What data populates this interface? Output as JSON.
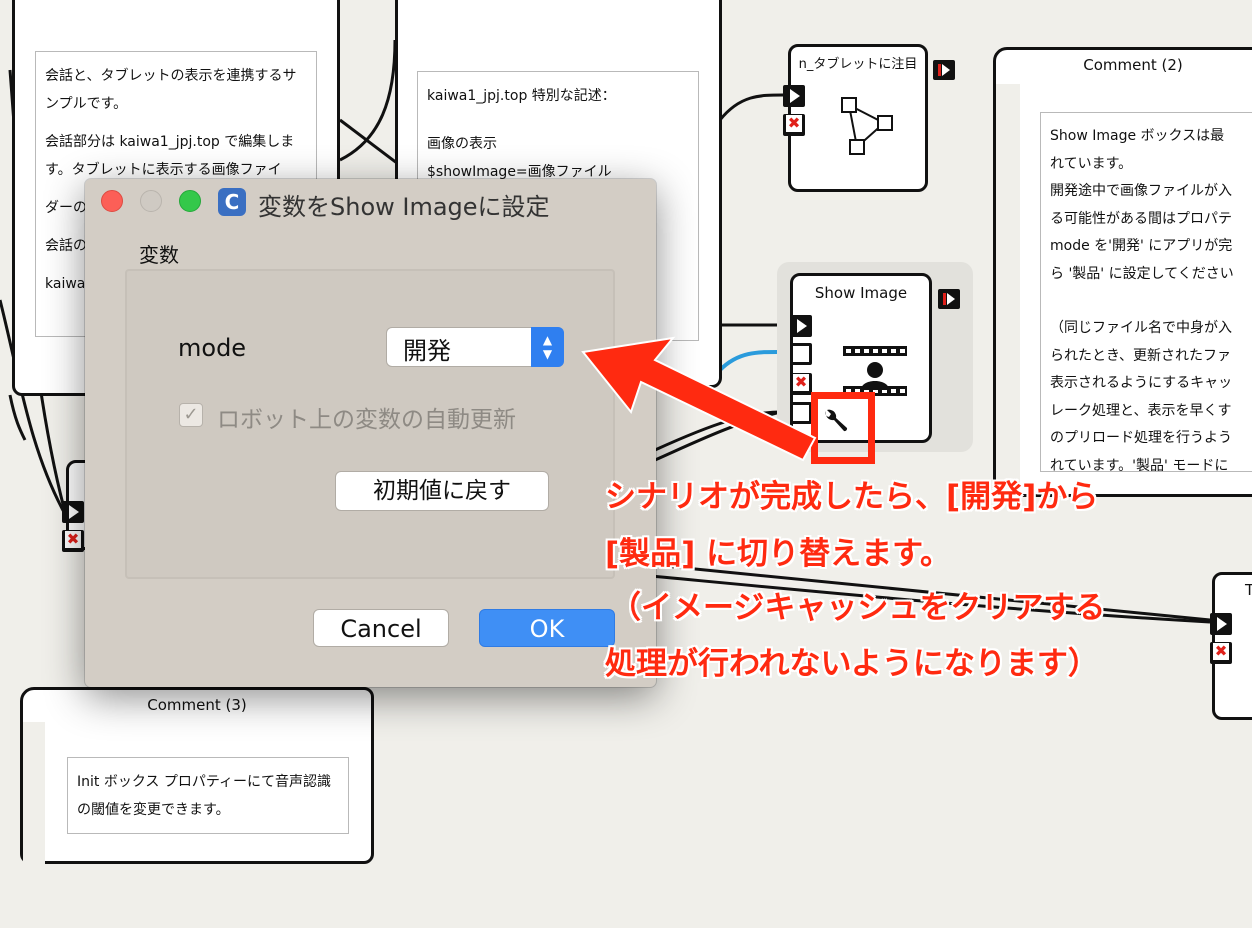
{
  "background_boxes": {
    "top_left_note": {
      "p1": "会話と、タブレットの表示を連携するサンプルです。",
      "p2": "会話部分は kaiwa1_jpj.top で編集します。タブレットに表示する画像ファイ",
      "p2_tail": "ダーの",
      "p3": "会話の",
      "p3_tail": "kaiwa"
    },
    "middle_note": {
      "line1": "kaiwa1_jpj.top 特別な記述：",
      "line2": "画像の表示",
      "line3": "$showImage=画像ファイル"
    },
    "tablet_box_title": "n_タブレットに注目",
    "show_image_box_title": "Show Image",
    "comment2": {
      "title": "Comment (2)",
      "text": [
        "Show Image ボックスは最",
        "れています。",
        "開発途中で画像ファイルが入",
        "る可能性がある間はプロパテ",
        "mode を'開発' にアプリが完",
        "ら '製品' に設定してください",
        "",
        "（同じファイル名で中身が入",
        "られたとき、更新されたファ",
        "表示されるようにするキャッ",
        "レーク処理と、表示を早くす",
        "のプリロード処理を行うよう",
        "れています。'製品' モードに"
      ]
    },
    "comment3": {
      "title": "Comment (3)",
      "text": "Init ボックス プロパティーにて音声認識の閾値を変更できます。"
    },
    "right_edge_box_title": "T"
  },
  "dialog": {
    "app_icon": "C",
    "title": "変数をShow Imageに設定",
    "section_label": "変数",
    "mode_label": "mode",
    "mode_value": "開発",
    "checkbox_label": "ロボット上の変数の自動更新",
    "checkbox_checked": true,
    "reset_button": "初期値に戻す",
    "cancel_button": "Cancel",
    "ok_button": "OK"
  },
  "annotation": {
    "color": "#ff2a10",
    "lines": [
      "シナリオが完成したら、[開発]から",
      "[製品] に切り替えます。",
      "（イメージキャッシュをクリアする",
      "処理が行われないようになります）"
    ]
  },
  "colors": {
    "canvas": "#f0efea",
    "dialog": "#d3cdc5",
    "ok_button": "#3f8ff5",
    "select_stepper": "#2f7ff0",
    "wire_blue": "#2a9bdc"
  }
}
